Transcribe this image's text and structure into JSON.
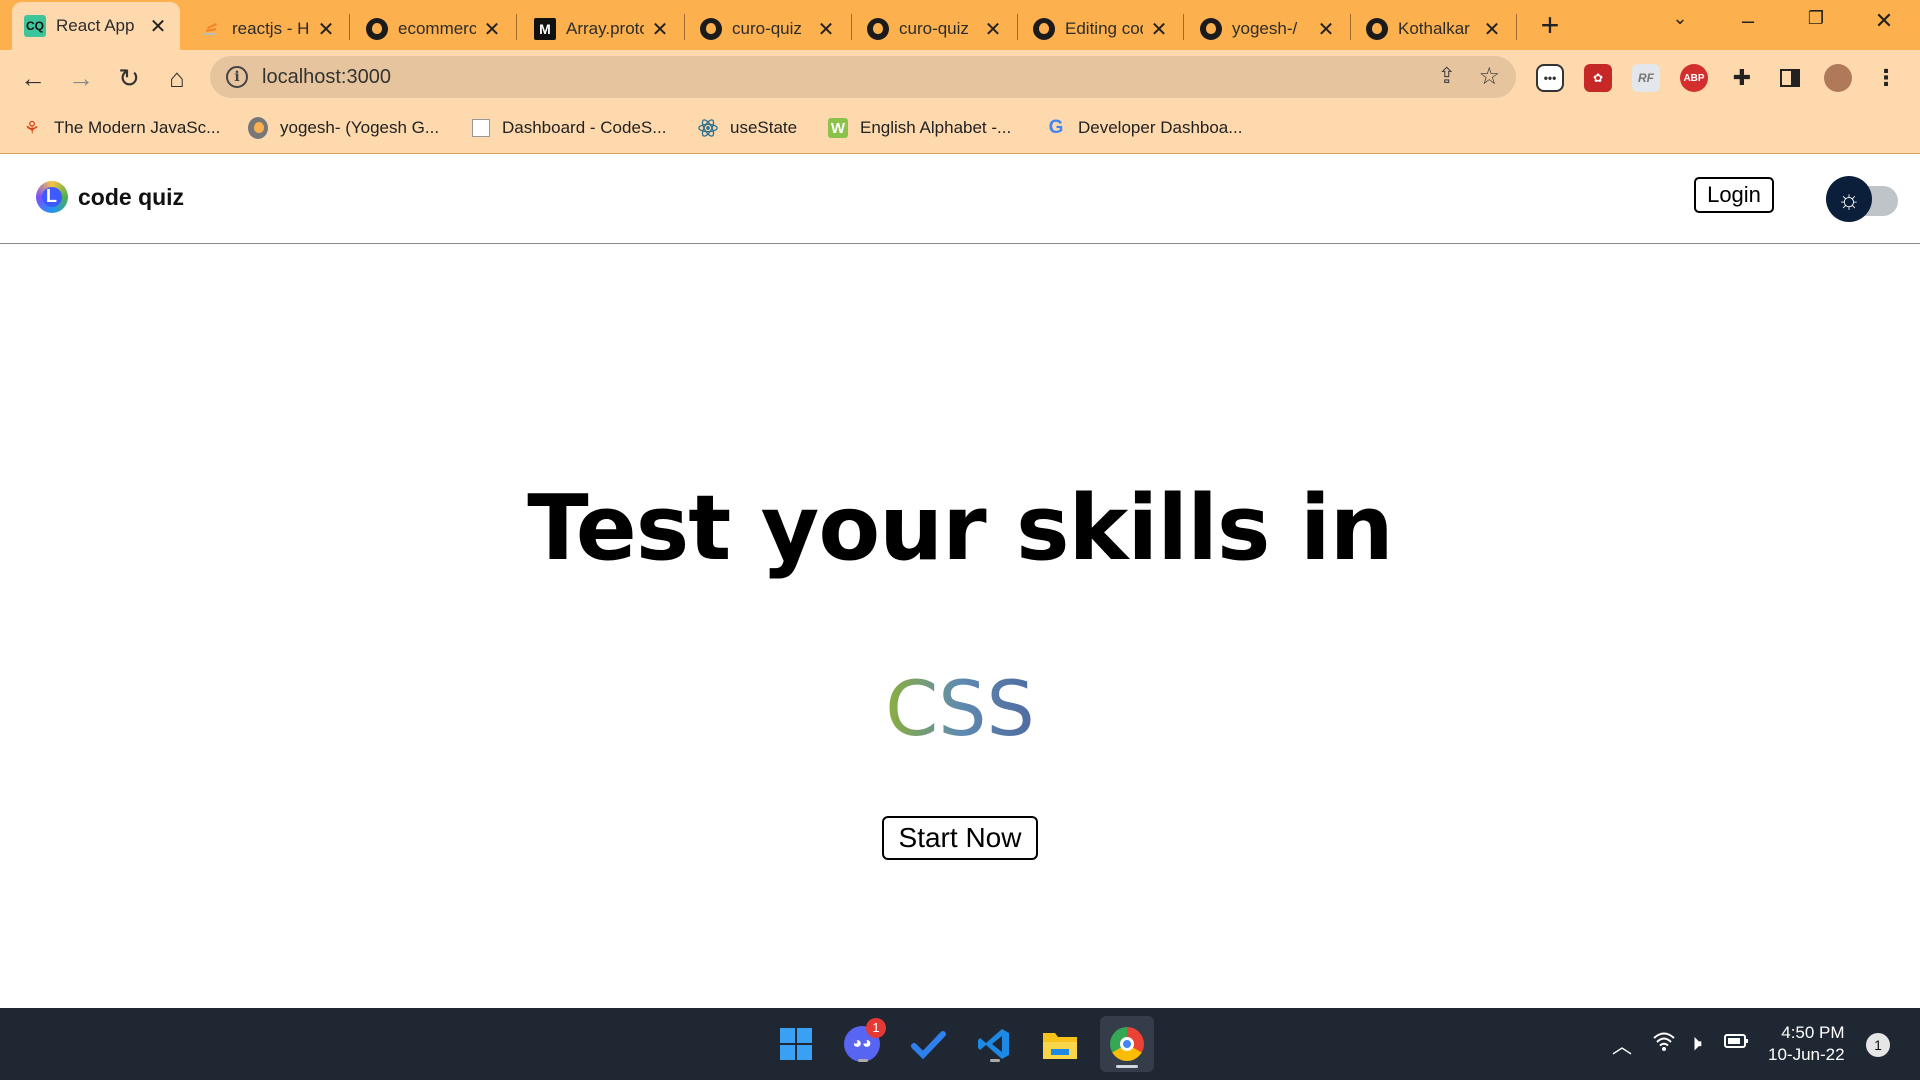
{
  "browser": {
    "tabs": [
      {
        "title": "React App",
        "favicon": "cq-favicon",
        "active": true
      },
      {
        "title": "reactjs - How",
        "favicon": "stackoverflow-icon"
      },
      {
        "title": "ecommerce",
        "favicon": "github-icon"
      },
      {
        "title": "Array.prototype",
        "favicon": "medium-icon"
      },
      {
        "title": "curo-quiz",
        "favicon": "github-icon"
      },
      {
        "title": "curo-quiz",
        "favicon": "github-icon"
      },
      {
        "title": "Editing code",
        "favicon": "github-icon"
      },
      {
        "title": "yogesh-/",
        "favicon": "github-icon"
      },
      {
        "title": "Kothalkar",
        "favicon": "github-icon"
      }
    ],
    "favicon_text": "CQ",
    "new_tab_symbol": "+",
    "url": "localhost:3000",
    "bookmarks": [
      {
        "label": "The Modern JavaSc...",
        "icon": "javascript-info-icon"
      },
      {
        "label": "yogesh- (Yogesh G...",
        "icon": "github-icon"
      },
      {
        "label": "Dashboard - CodeS...",
        "icon": "page-icon"
      },
      {
        "label": "useState",
        "icon": "react-icon"
      },
      {
        "label": "English Alphabet -...",
        "icon": "w-icon"
      },
      {
        "label": "Developer Dashboa...",
        "icon": "google-icon"
      }
    ],
    "extensions": [
      {
        "name": "dots-extension-icon"
      },
      {
        "name": "paw-extension-icon"
      },
      {
        "name": "rf-extension-icon",
        "text": "RF"
      },
      {
        "name": "adblock-plus-icon",
        "text": "ABP"
      },
      {
        "name": "puzzle-extensions-icon"
      },
      {
        "name": "side-panel-icon"
      },
      {
        "name": "profile-avatar-icon"
      },
      {
        "name": "kebab-menu-icon"
      }
    ]
  },
  "app": {
    "brand_name": "code quiz",
    "brand_logo_letter": "L",
    "login_label": "Login",
    "hero_title": "Test your skills in",
    "hero_topic": "CSS",
    "start_label": "Start Now",
    "theme_mode": "light"
  },
  "taskbar": {
    "apps": [
      "windows-start-icon",
      "discord-icon",
      "todo-icon",
      "vscode-icon",
      "file-explorer-icon",
      "chrome-icon"
    ],
    "discord_badge": "1",
    "time": "4:50 PM",
    "date": "10-Jun-22",
    "notification_count": "1"
  },
  "colors": {
    "tabstrip": "#fcb04e",
    "toolbar": "#fdd9ad",
    "taskbar": "#1f2733",
    "hero_gradient": [
      "#8cb03c",
      "#5f8ab0",
      "#4f6aa0"
    ]
  }
}
